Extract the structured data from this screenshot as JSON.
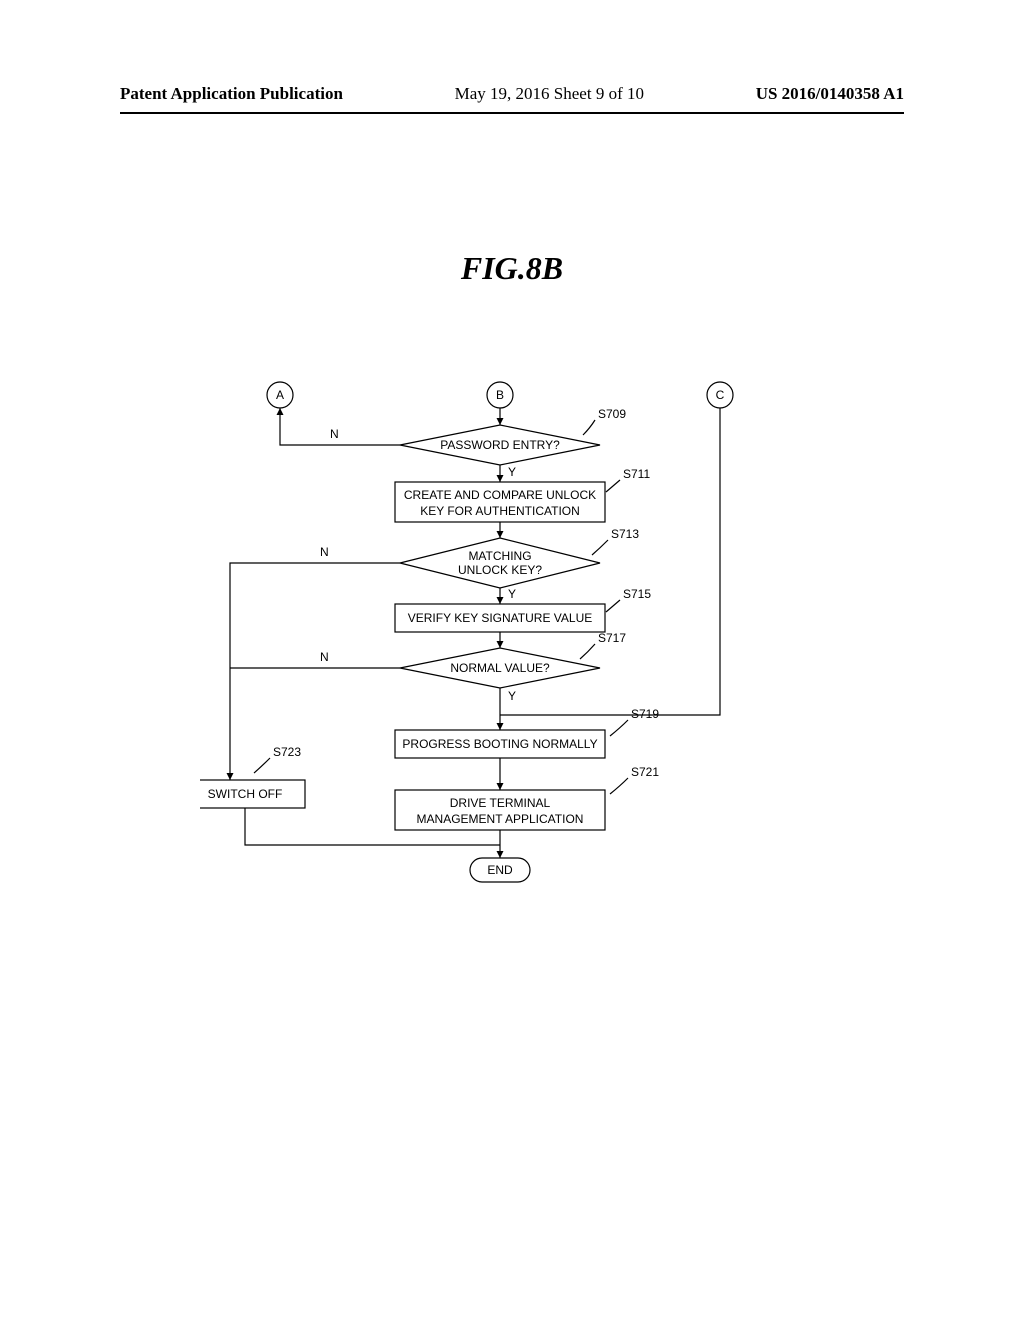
{
  "header": {
    "left": "Patent Application Publication",
    "center": "May 19, 2016  Sheet 9 of 10",
    "right": "US 2016/0140358 A1"
  },
  "figure": {
    "title": "FIG.8B"
  },
  "connectors": {
    "a": "A",
    "b": "B",
    "c": "C"
  },
  "steps": {
    "s709": {
      "label": "S709",
      "text": "PASSWORD ENTRY?"
    },
    "s711": {
      "label": "S711",
      "text1": "CREATE AND COMPARE UNLOCK",
      "text2": "KEY FOR AUTHENTICATION"
    },
    "s713": {
      "label": "S713",
      "text1": "MATCHING",
      "text2": "UNLOCK KEY?"
    },
    "s715": {
      "label": "S715",
      "text": "VERIFY KEY SIGNATURE VALUE"
    },
    "s717": {
      "label": "S717",
      "text": "NORMAL VALUE?"
    },
    "s719": {
      "label": "S719",
      "text": "PROGRESS BOOTING NORMALLY"
    },
    "s721": {
      "label": "S721",
      "text1": "DRIVE TERMINAL",
      "text2": "MANAGEMENT APPLICATION"
    },
    "s723": {
      "label": "S723",
      "text": "SWITCH OFF"
    }
  },
  "terminators": {
    "end": "END"
  },
  "branches": {
    "yes": "Y",
    "no": "N"
  }
}
